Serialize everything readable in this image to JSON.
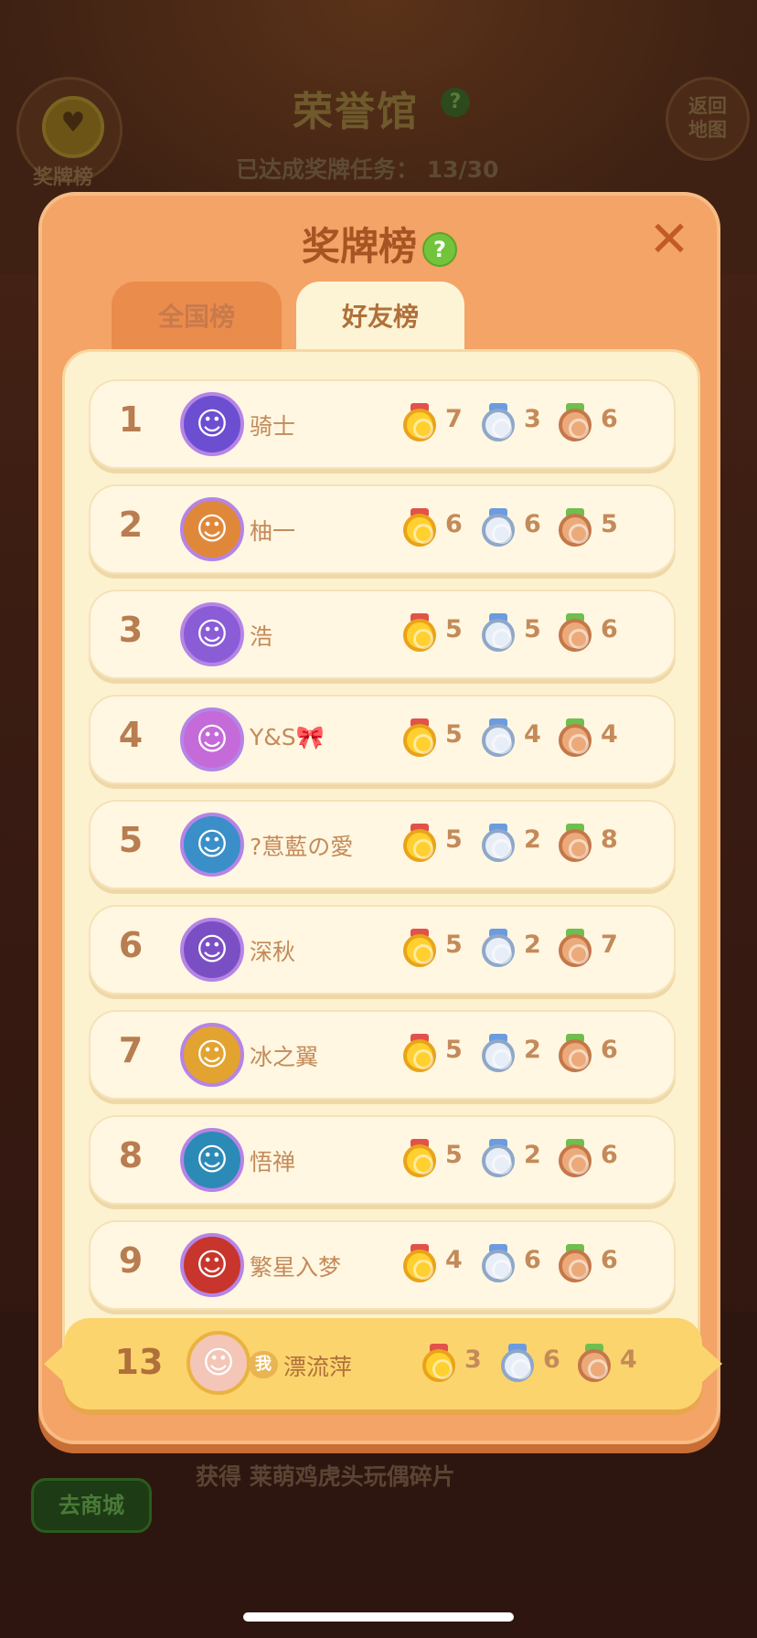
{
  "background": {
    "medal_board_label": "奖牌榜",
    "title": "荣誉馆",
    "title_help": "?",
    "progress_text": "已达成奖牌任务： 13/30",
    "back_button": "返回\n地图",
    "shop_button": "去商城",
    "reward_text": "获得 莱萌鸡虎头玩偶碎片"
  },
  "popup": {
    "title": "奖牌榜",
    "help": "?",
    "close": "✕",
    "tabs": [
      {
        "label": "全国榜",
        "active": false
      },
      {
        "label": "好友榜",
        "active": true
      }
    ]
  },
  "rows": [
    {
      "rank": "1",
      "name": "骑士",
      "gold": "7",
      "silver": "3",
      "bronze": "6",
      "avatar_color": "#6c4ed1"
    },
    {
      "rank": "2",
      "name": "柚一",
      "gold": "6",
      "silver": "6",
      "bronze": "5",
      "avatar_color": "#e0883a"
    },
    {
      "rank": "3",
      "name": "浩",
      "gold": "5",
      "silver": "5",
      "bronze": "6",
      "avatar_color": "#8a5cd6"
    },
    {
      "rank": "4",
      "name": "Y&S🎀",
      "gold": "5",
      "silver": "4",
      "bronze": "4",
      "avatar_color": "#c56ad9"
    },
    {
      "rank": "5",
      "name": "?蒠藍の愛",
      "gold": "5",
      "silver": "2",
      "bronze": "8",
      "avatar_color": "#3a8fc9"
    },
    {
      "rank": "6",
      "name": "深秋",
      "gold": "5",
      "silver": "2",
      "bronze": "7",
      "avatar_color": "#7b4fc4"
    },
    {
      "rank": "7",
      "name": "冰之翼",
      "gold": "5",
      "silver": "2",
      "bronze": "6",
      "avatar_color": "#e2a330"
    },
    {
      "rank": "8",
      "name": "悟禅",
      "gold": "5",
      "silver": "2",
      "bronze": "6",
      "avatar_color": "#2c8ab6"
    },
    {
      "rank": "9",
      "name": "繁星入梦",
      "gold": "4",
      "silver": "6",
      "bronze": "6",
      "avatar_color": "#c8352c"
    }
  ],
  "self": {
    "rank": "13",
    "me_badge": "我",
    "name": "漂流萍",
    "gold": "3",
    "silver": "6",
    "bronze": "4"
  }
}
